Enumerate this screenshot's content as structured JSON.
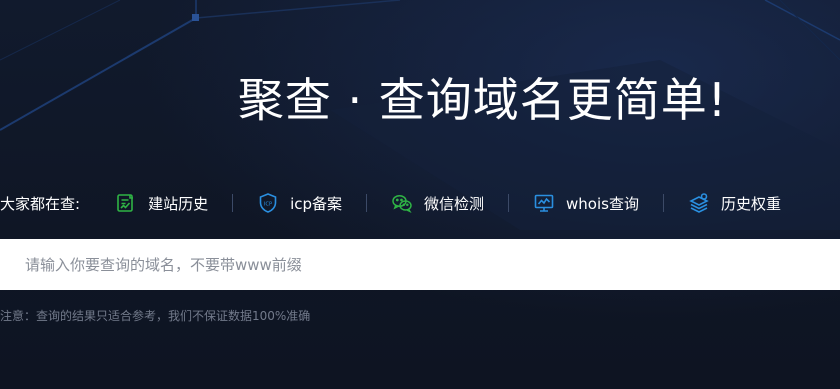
{
  "hero": {
    "title": "聚查 · 查询域名更简单!"
  },
  "tags": {
    "label": "大家都在查:",
    "items": [
      {
        "label": "建站历史",
        "icon": "history-document-icon",
        "color": "#2fb345"
      },
      {
        "label": "icp备案",
        "icon": "icp-shield-icon",
        "color": "#2a8fe0"
      },
      {
        "label": "微信检测",
        "icon": "wechat-icon",
        "color": "#2fb345"
      },
      {
        "label": "whois查询",
        "icon": "monitor-chart-icon",
        "color": "#2a8fe0"
      },
      {
        "label": "历史权重",
        "icon": "layers-icon",
        "color": "#2a8fe0"
      }
    ]
  },
  "search": {
    "placeholder": "请输入你要查询的域名，不要带www前缀"
  },
  "note": "注意：查询的结果只适合参考，我们不保证数据100%准确"
}
